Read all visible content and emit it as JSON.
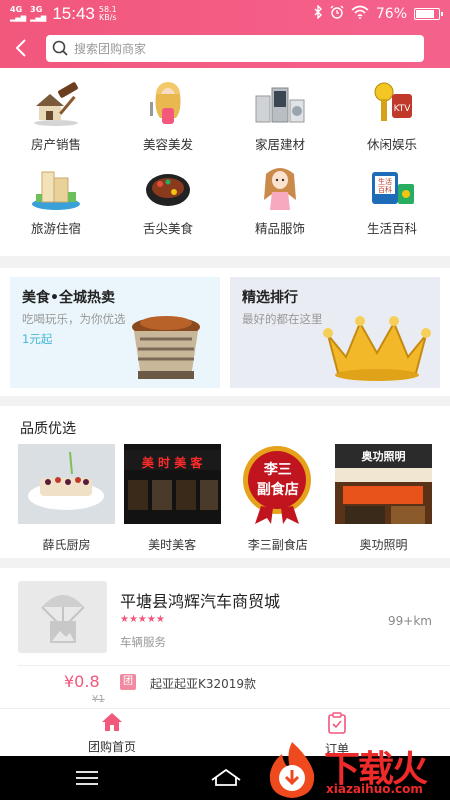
{
  "status_bar": {
    "network1": "4G",
    "network2": "3G",
    "time": "15:43",
    "speed_value": "58.1",
    "speed_unit": "KB/s",
    "battery": "76%"
  },
  "search": {
    "placeholder": "搜索团购商家"
  },
  "categories": [
    {
      "label": "房产销售",
      "icon": "house-gavel-icon"
    },
    {
      "label": "美容美发",
      "icon": "beauty-woman-icon"
    },
    {
      "label": "家居建材",
      "icon": "appliances-icon"
    },
    {
      "label": "休闲娱乐",
      "icon": "microphone-icon"
    },
    {
      "label": "旅游住宿",
      "icon": "resort-building-icon"
    },
    {
      "label": "舌尖美食",
      "icon": "steak-plate-icon"
    },
    {
      "label": "精品服饰",
      "icon": "fashion-girl-icon"
    },
    {
      "label": "生活百科",
      "icon": "life-book-icon"
    }
  ],
  "promos": [
    {
      "title": "美食•全城热卖",
      "subtitle": "吃喝玩乐，为你优选",
      "price_tag": "1元起"
    },
    {
      "title": "精选排行",
      "subtitle": "最好的都在这里"
    }
  ],
  "quality": {
    "heading": "品质优选",
    "shops": [
      {
        "name": "薛氏厨房"
      },
      {
        "name": "美时美客",
        "sign_text": "美 时 美 客"
      },
      {
        "name": "李三副食店",
        "sign_text": "李三\n副食店"
      },
      {
        "name": "奥功照明",
        "sign_text": "奥功照明"
      }
    ]
  },
  "listing": {
    "title": "平塘县鸿辉汽车商贸城",
    "stars": "★★★★★",
    "tag": "车辆服务",
    "distance": "99+km",
    "price": "¥0.8",
    "old_price": "¥1",
    "badge": "团",
    "deal": "起亚起亚K32019款"
  },
  "tabs": {
    "home": "团购首页",
    "orders": "订单"
  },
  "watermark": {
    "title": "下载火",
    "url": "xiazaihuo.com"
  },
  "colors": {
    "brand": "#f2577c",
    "accent_blue": "#46b7d6"
  }
}
